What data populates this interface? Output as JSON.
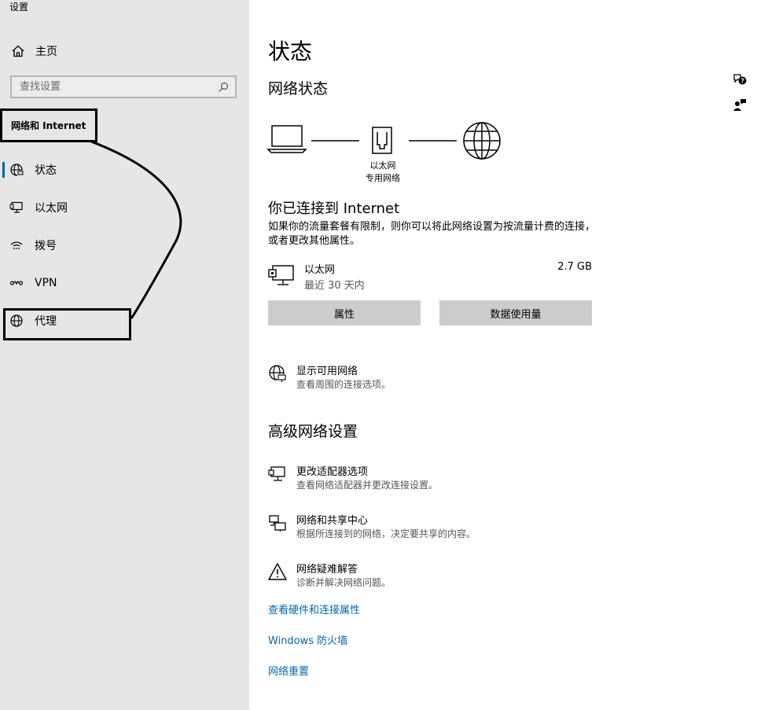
{
  "app": {
    "title": "设置"
  },
  "sidebar": {
    "home": {
      "label": "主页",
      "icon": "home-icon"
    },
    "search": {
      "placeholder": "查找设置",
      "icon": "search-icon"
    },
    "section": "网络和 Internet",
    "items": [
      {
        "label": "状态",
        "icon": "globe-status-icon",
        "active": true
      },
      {
        "label": "以太网",
        "icon": "ethernet-icon"
      },
      {
        "label": "拨号",
        "icon": "dialup-icon"
      },
      {
        "label": "VPN",
        "icon": "vpn-icon"
      },
      {
        "label": "代理",
        "icon": "globe-icon"
      }
    ]
  },
  "main": {
    "title": "状态",
    "network_status": "网络状态",
    "diagram": {
      "line1": "以太网",
      "line2": "专用网络"
    },
    "connected_title": "你已连接到 Internet",
    "connected_desc": "如果你的流量套餐有限制，则你可以将此网络设置为按流量计费的连接，或者更改其他属性。",
    "ethernet": {
      "name": "以太网",
      "sub": "最近 30 天内",
      "size": "2.7 GB"
    },
    "buttons": {
      "properties": "属性",
      "data_usage": "数据使用量"
    },
    "show_networks": {
      "title": "显示可用网络",
      "desc": "查看周围的连接选项。"
    },
    "advanced_title": "高级网络设置",
    "advanced_items": [
      {
        "title": "更改适配器选项",
        "desc": "查看网络适配器并更改连接设置。",
        "icon": "adapter-icon"
      },
      {
        "title": "网络和共享中心",
        "desc": "根据所连接到的网络，决定要共享的内容。",
        "icon": "sharing-center-icon"
      },
      {
        "title": "网络疑难解答",
        "desc": "诊断并解决网络问题。",
        "icon": "warning-icon"
      }
    ],
    "links": [
      "查看硬件和连接属性",
      "Windows 防火墙",
      "网络重置"
    ]
  },
  "colors": {
    "sidebar_bg": "#e6e6e6",
    "accent": "#0063b1",
    "link": "#0067b8",
    "button_bg": "#cccccc"
  }
}
